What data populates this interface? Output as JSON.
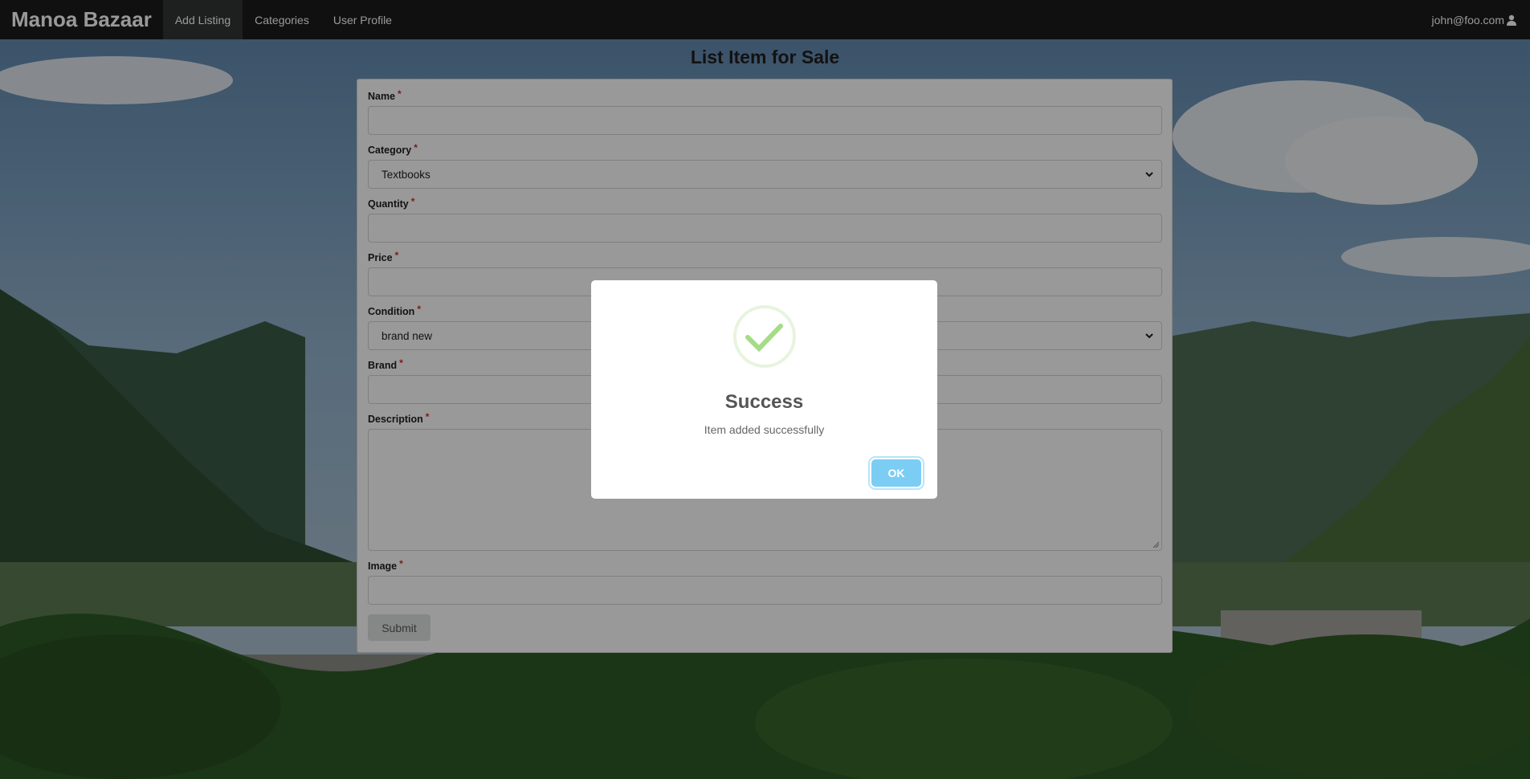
{
  "navbar": {
    "brand": "Manoa Bazaar",
    "items": [
      {
        "label": "Add Listing",
        "active": true
      },
      {
        "label": "Categories",
        "active": false
      },
      {
        "label": "User Profile",
        "active": false
      }
    ],
    "user_email": "john@foo.com",
    "user_icon": "user-icon"
  },
  "form": {
    "title": "List Item for Sale",
    "required_marker": "*",
    "fields": {
      "name": {
        "label": "Name",
        "value": ""
      },
      "category": {
        "label": "Category",
        "value": "Textbooks"
      },
      "quantity": {
        "label": "Quantity",
        "value": ""
      },
      "price": {
        "label": "Price",
        "value": ""
      },
      "condition": {
        "label": "Condition",
        "value": "brand new"
      },
      "brand": {
        "label": "Brand",
        "value": ""
      },
      "description": {
        "label": "Description",
        "value": ""
      },
      "image": {
        "label": "Image",
        "value": ""
      }
    },
    "submit_label": "Submit"
  },
  "dialog": {
    "icon": "checkmark-icon",
    "title": "Success",
    "message": "Item added successfully",
    "ok_label": "OK"
  },
  "colors": {
    "navbar_bg": "#1b1c1d",
    "ok_button": "#7ccdf4",
    "success_check": "#a5dc86",
    "required": "#db2828"
  }
}
